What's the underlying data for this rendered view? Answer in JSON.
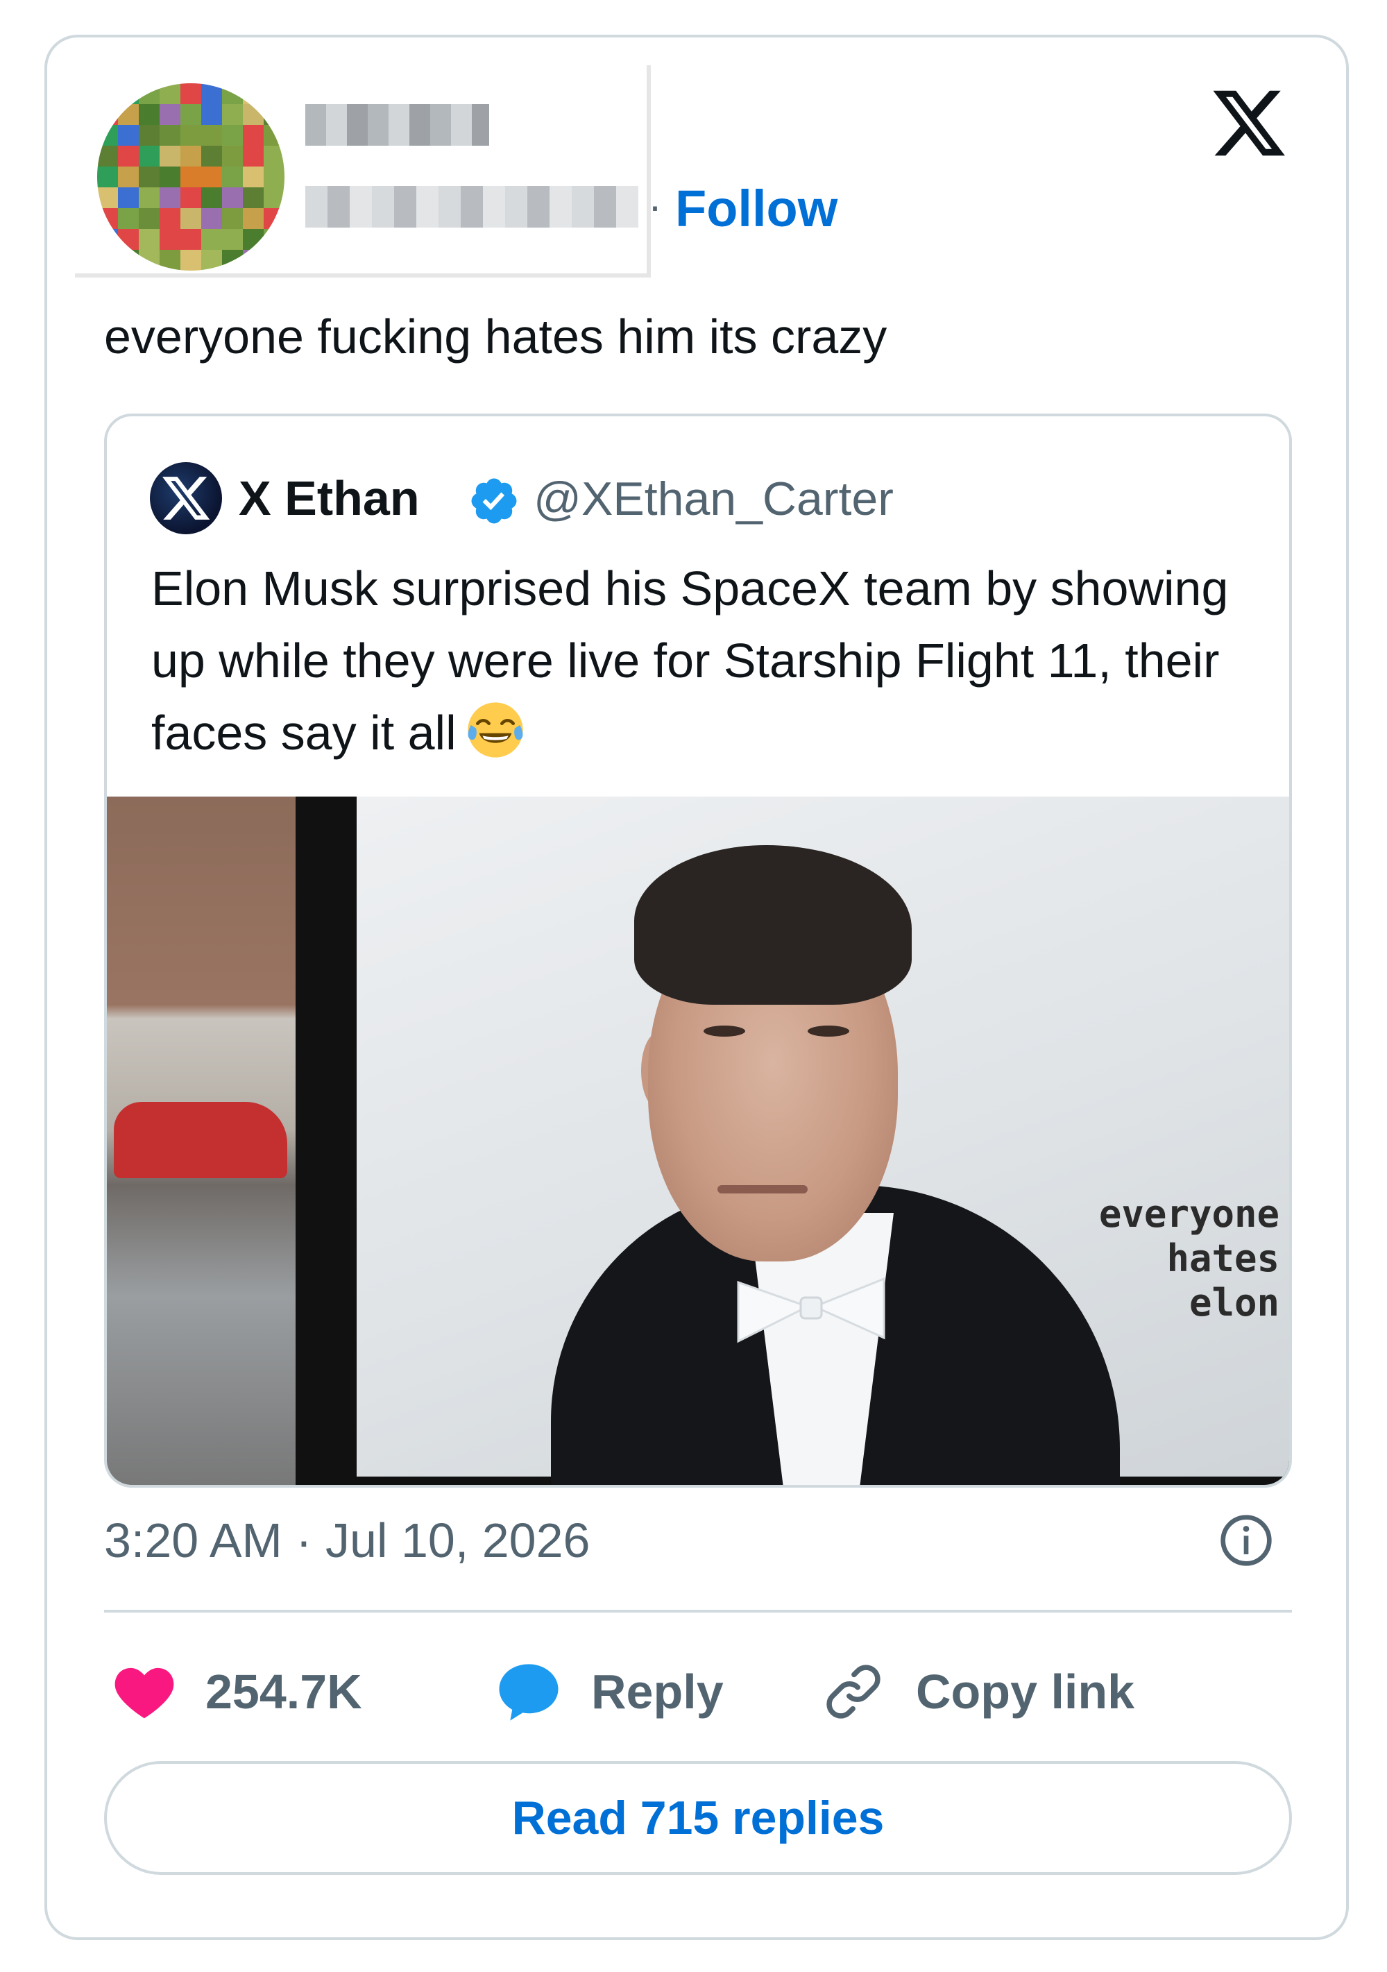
{
  "header": {
    "follow_label": "Follow",
    "separator": "·",
    "logo_icon": "x-logo-icon"
  },
  "tweet": {
    "text": "everyone fucking hates him its crazy",
    "timestamp": "3:20 AM · Jul 10, 2026"
  },
  "quoted_tweet": {
    "author_name": "X Ethan",
    "author_handle": "@XEthan_Carter",
    "verified": true,
    "text": "Elon Musk surprised his SpaceX team by showing up while they were live for Starship Flight 11, their faces say it all",
    "emoji": "face-with-tears-of-joy",
    "media_caption": [
      "everyone",
      "hates elon"
    ]
  },
  "actions": {
    "likes": "254.7K",
    "reply_label": "Reply",
    "copy_label": "Copy link"
  },
  "read_replies_label": "Read 715 replies",
  "colors": {
    "accent_blue": "#006fd6",
    "like_pink": "#f91880",
    "reply_blue": "#1d9bf0",
    "muted": "#536471",
    "border": "#cfd9de"
  }
}
